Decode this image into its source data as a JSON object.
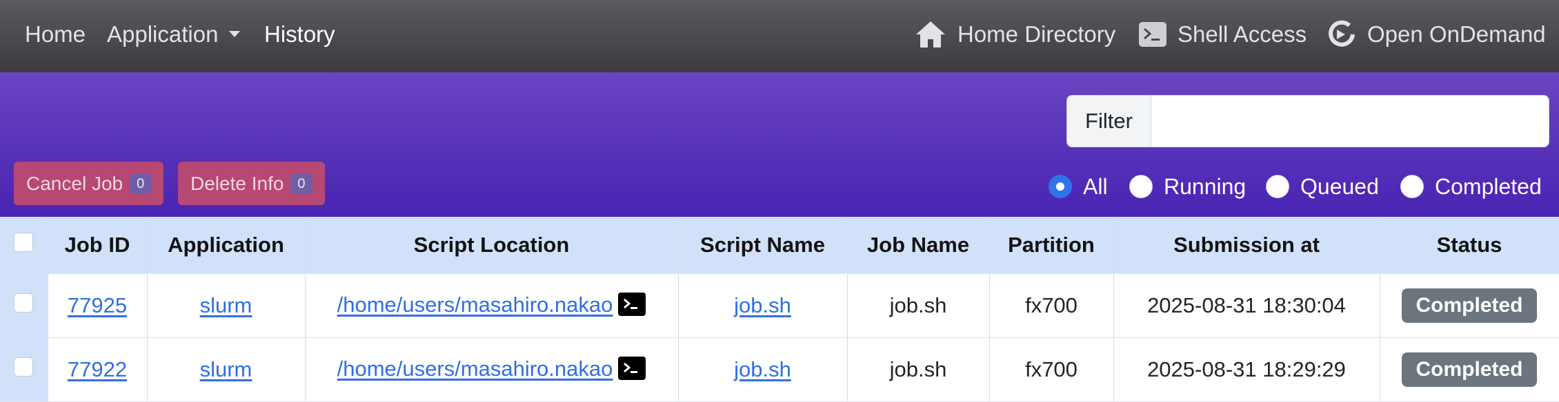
{
  "nav": {
    "home": "Home",
    "application": "Application",
    "history": "History",
    "home_directory": "Home Directory",
    "shell_access": "Shell Access",
    "open_ondemand": "Open OnDemand"
  },
  "filter": {
    "label": "Filter",
    "value": ""
  },
  "actions": {
    "cancel_label": "Cancel Job",
    "cancel_count": "0",
    "delete_label": "Delete Info",
    "delete_count": "0"
  },
  "status_filter": {
    "options": [
      "All",
      "Running",
      "Queued",
      "Completed"
    ],
    "selected": "All"
  },
  "table": {
    "headers": [
      "Job ID",
      "Application",
      "Script Location",
      "Script Name",
      "Job Name",
      "Partition",
      "Submission at",
      "Status"
    ],
    "rows": [
      {
        "job_id": "77925",
        "application": "slurm",
        "script_location": "/home/users/masahiro.nakao",
        "script_name": "job.sh",
        "job_name": "job.sh",
        "partition": "fx700",
        "submitted": "2025-08-31 18:30:04",
        "status": "Completed"
      },
      {
        "job_id": "77922",
        "application": "slurm",
        "script_location": "/home/users/masahiro.nakao",
        "script_name": "job.sh",
        "job_name": "job.sh",
        "partition": "fx700",
        "submitted": "2025-08-31 18:29:29",
        "status": "Completed"
      }
    ]
  },
  "colors": {
    "nav_bg": "#4a494e",
    "band_purple": "#5530b8",
    "table_header_bg": "#d2e1fa",
    "action_button": "#b64873",
    "link": "#2f6fe0",
    "status_badge": "#6c757d",
    "radio_selected": "#2f73ea"
  },
  "icons": [
    "house-icon",
    "terminal-icon",
    "ondemand-logo-icon",
    "chevron-down-icon"
  ]
}
